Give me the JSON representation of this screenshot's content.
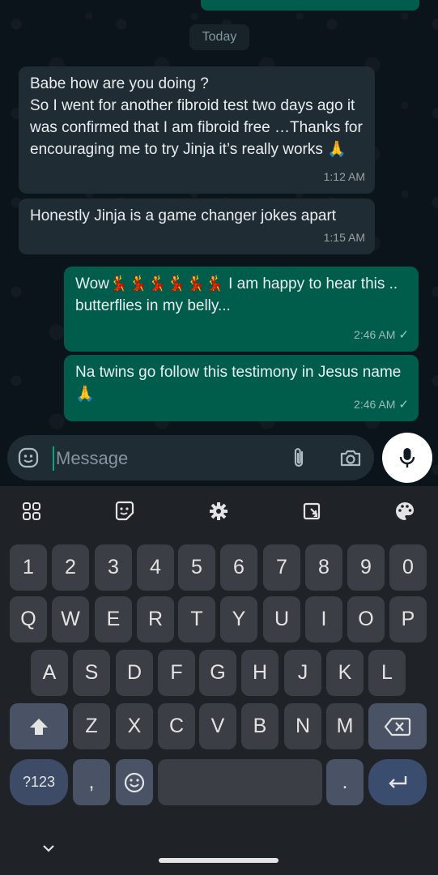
{
  "chat": {
    "day_label": "Today",
    "messages": [
      {
        "direction": "in",
        "text": "Babe how are you doing ?\nSo I went for another fibroid test two days ago it was confirmed that I am fibroid free …Thanks for encouraging me to try Jinja it’s really works 🙏",
        "time": "1:12 AM"
      },
      {
        "direction": "in",
        "text": "Honestly Jinja is a game changer jokes apart",
        "time": "1:15 AM"
      },
      {
        "direction": "out",
        "text": "Wow💃💃💃💃💃💃 I am happy to hear this .. butterflies in my belly...",
        "time": "2:46 AM",
        "status": "✓"
      },
      {
        "direction": "out",
        "text": "Na twins go follow this testimony in Jesus name 🙏",
        "time": "2:46 AM",
        "status": "✓"
      }
    ]
  },
  "composer": {
    "placeholder": "Message",
    "icons": {
      "emoji": "sticker-emoji-icon",
      "attach": "paperclip-icon",
      "camera": "camera-icon",
      "mic": "microphone-icon"
    }
  },
  "keyboard": {
    "toolbar_icons": [
      "apps-grid-icon",
      "sticker-icon",
      "settings-gear-icon",
      "clipboard-icon",
      "theme-palette-icon"
    ],
    "number_row": [
      "1",
      "2",
      "3",
      "4",
      "5",
      "6",
      "7",
      "8",
      "9",
      "0"
    ],
    "row1": [
      "Q",
      "W",
      "E",
      "R",
      "T",
      "Y",
      "U",
      "I",
      "O",
      "P"
    ],
    "row2": [
      "A",
      "S",
      "D",
      "F",
      "G",
      "H",
      "J",
      "K",
      "L"
    ],
    "row3": [
      "Z",
      "X",
      "C",
      "V",
      "B",
      "N",
      "M"
    ],
    "symbols_label": "?123",
    "comma": ",",
    "period": ".",
    "colors": {
      "background": "#1f2226",
      "key": "#3b3e44",
      "accent": "#3d4b66"
    }
  },
  "colors": {
    "chat_bg": "#0b141a",
    "incoming": "#202c33",
    "outgoing": "#005c4b",
    "accent": "#00a884"
  }
}
